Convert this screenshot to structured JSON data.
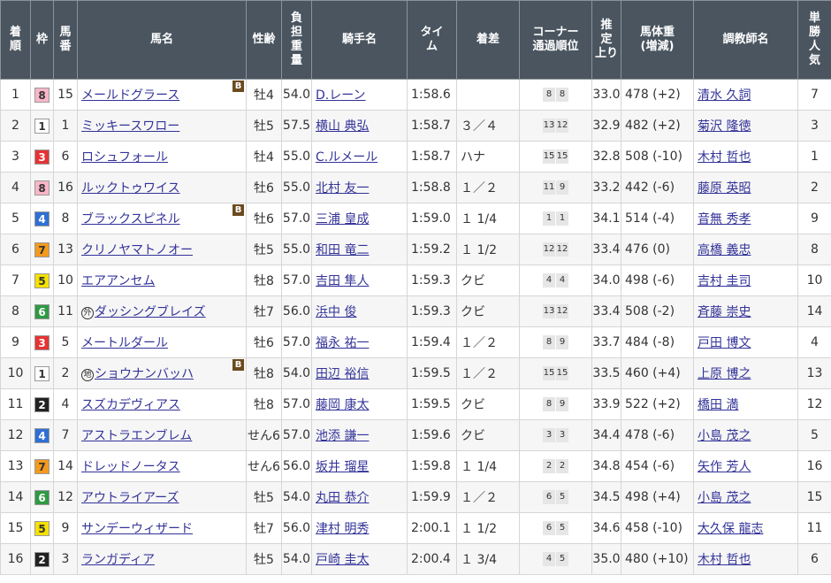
{
  "headers": [
    {
      "label": "着\n順"
    },
    {
      "label": "枠"
    },
    {
      "label": "馬\n番"
    },
    {
      "label": "馬名"
    },
    {
      "label": "性齢"
    },
    {
      "label": "負\n担\n重\n量"
    },
    {
      "label": "騎手名"
    },
    {
      "label": "タイ\nム"
    },
    {
      "label": "着差"
    },
    {
      "label": "コーナー\n通過順位"
    },
    {
      "label": "推\n定\n上り"
    },
    {
      "label": "馬体重\n(増減)"
    },
    {
      "label": "調教師名"
    },
    {
      "label": "単\n勝\n人\n気"
    }
  ],
  "waku_colors": {
    "1": {
      "bg": "#ffffff",
      "fg": "#333333"
    },
    "2": {
      "bg": "#222222",
      "fg": "#ffffff"
    },
    "3": {
      "bg": "#e63333",
      "fg": "#ffffff"
    },
    "4": {
      "bg": "#2f6fd6",
      "fg": "#ffffff"
    },
    "5": {
      "bg": "#f5e000",
      "fg": "#333333"
    },
    "6": {
      "bg": "#2e9a44",
      "fg": "#ffffff"
    },
    "7": {
      "bg": "#f39a1e",
      "fg": "#333333"
    },
    "8": {
      "bg": "#f8b6c8",
      "fg": "#333333"
    }
  },
  "rows": [
    {
      "rank": "1",
      "waku": "8",
      "num": "15",
      "mark": "",
      "mark_icon": "",
      "horse": "メールドグラース",
      "blinker": "B",
      "sexage": "牡4",
      "weight": "54.0",
      "jockey": "D.レーン",
      "time": "1:58.6",
      "margin": "",
      "c1": "8",
      "c2": "8",
      "last3f": "33.0",
      "body": "478 (+2)",
      "trainer": "清水 久詞",
      "pop": "7"
    },
    {
      "rank": "2",
      "waku": "1",
      "num": "1",
      "mark": "",
      "mark_icon": "",
      "horse": "ミッキースワロー",
      "blinker": "",
      "sexage": "牡5",
      "weight": "57.5",
      "jockey": "横山 典弘",
      "time": "1:58.7",
      "margin": "３／４",
      "c1": "13",
      "c2": "12",
      "last3f": "32.9",
      "body": "482 (+2)",
      "trainer": "菊沢 隆徳",
      "pop": "3"
    },
    {
      "rank": "3",
      "waku": "3",
      "num": "6",
      "mark": "",
      "mark_icon": "",
      "horse": "ロシュフォール",
      "blinker": "",
      "sexage": "牡4",
      "weight": "55.0",
      "jockey": "C.ルメール",
      "time": "1:58.7",
      "margin": "ハナ",
      "c1": "15",
      "c2": "15",
      "last3f": "32.8",
      "body": "508 (-10)",
      "trainer": "木村 哲也",
      "pop": "1"
    },
    {
      "rank": "4",
      "waku": "8",
      "num": "16",
      "mark": "",
      "mark_icon": "",
      "horse": "ルックトゥワイス",
      "blinker": "",
      "sexage": "牡6",
      "weight": "55.0",
      "jockey": "北村 友一",
      "time": "1:58.8",
      "margin": "１／２",
      "c1": "11",
      "c2": "9",
      "last3f": "33.2",
      "body": "442 (-6)",
      "trainer": "藤原 英昭",
      "pop": "2"
    },
    {
      "rank": "5",
      "waku": "4",
      "num": "8",
      "mark": "",
      "mark_icon": "",
      "horse": "ブラックスピネル",
      "blinker": "B",
      "sexage": "牡6",
      "weight": "57.0",
      "jockey": "三浦 皇成",
      "time": "1:59.0",
      "margin": "１ 1/4",
      "c1": "1",
      "c2": "1",
      "last3f": "34.1",
      "body": "514 (-4)",
      "trainer": "音無 秀孝",
      "pop": "9"
    },
    {
      "rank": "6",
      "waku": "7",
      "num": "13",
      "mark": "",
      "mark_icon": "",
      "horse": "クリノヤマトノオー",
      "blinker": "",
      "sexage": "牡5",
      "weight": "55.0",
      "jockey": "和田 竜二",
      "time": "1:59.2",
      "margin": "１ 1/2",
      "c1": "12",
      "c2": "12",
      "last3f": "33.4",
      "body": "476 (0)",
      "trainer": "高橋 義忠",
      "pop": "8"
    },
    {
      "rank": "7",
      "waku": "5",
      "num": "10",
      "mark": "",
      "mark_icon": "",
      "horse": "エアアンセム",
      "blinker": "",
      "sexage": "牡8",
      "weight": "57.0",
      "jockey": "吉田 隼人",
      "time": "1:59.3",
      "margin": "クビ",
      "c1": "4",
      "c2": "4",
      "last3f": "34.0",
      "body": "498 (-6)",
      "trainer": "吉村 圭司",
      "pop": "10"
    },
    {
      "rank": "8",
      "waku": "6",
      "num": "11",
      "mark": "外",
      "mark_icon": "foreign-mark-icon",
      "horse": "ダッシングブレイズ",
      "blinker": "",
      "sexage": "牡7",
      "weight": "56.0",
      "jockey": "浜中 俊",
      "time": "1:59.3",
      "margin": "クビ",
      "c1": "13",
      "c2": "12",
      "last3f": "33.4",
      "body": "508 (-2)",
      "trainer": "斉藤 崇史",
      "pop": "14"
    },
    {
      "rank": "9",
      "waku": "3",
      "num": "5",
      "mark": "",
      "mark_icon": "",
      "horse": "メートルダール",
      "blinker": "",
      "sexage": "牡6",
      "weight": "57.0",
      "jockey": "福永 祐一",
      "time": "1:59.4",
      "margin": "１／２",
      "c1": "8",
      "c2": "9",
      "last3f": "33.7",
      "body": "484 (-8)",
      "trainer": "戸田 博文",
      "pop": "4"
    },
    {
      "rank": "10",
      "waku": "1",
      "num": "2",
      "mark": "地",
      "mark_icon": "local-mark-icon",
      "horse": "ショウナンバッハ",
      "blinker": "B",
      "sexage": "牡8",
      "weight": "54.0",
      "jockey": "田辺 裕信",
      "time": "1:59.5",
      "margin": "１／２",
      "c1": "15",
      "c2": "15",
      "last3f": "33.5",
      "body": "460 (+4)",
      "trainer": "上原 博之",
      "pop": "13"
    },
    {
      "rank": "11",
      "waku": "2",
      "num": "4",
      "mark": "",
      "mark_icon": "",
      "horse": "スズカデヴィアス",
      "blinker": "",
      "sexage": "牡8",
      "weight": "57.0",
      "jockey": "藤岡 康太",
      "time": "1:59.5",
      "margin": "クビ",
      "c1": "8",
      "c2": "9",
      "last3f": "33.9",
      "body": "522 (+2)",
      "trainer": "橋田 満",
      "pop": "12"
    },
    {
      "rank": "12",
      "waku": "4",
      "num": "7",
      "mark": "",
      "mark_icon": "",
      "horse": "アストラエンブレム",
      "blinker": "",
      "sexage": "せん6",
      "weight": "57.0",
      "jockey": "池添 謙一",
      "time": "1:59.6",
      "margin": "クビ",
      "c1": "3",
      "c2": "3",
      "last3f": "34.4",
      "body": "478 (-6)",
      "trainer": "小島 茂之",
      "pop": "5"
    },
    {
      "rank": "13",
      "waku": "7",
      "num": "14",
      "mark": "",
      "mark_icon": "",
      "horse": "ドレッドノータス",
      "blinker": "",
      "sexage": "せん6",
      "weight": "56.0",
      "jockey": "坂井 瑠星",
      "time": "1:59.8",
      "margin": "１ 1/4",
      "c1": "2",
      "c2": "2",
      "last3f": "34.8",
      "body": "454 (-6)",
      "trainer": "矢作 芳人",
      "pop": "16"
    },
    {
      "rank": "14",
      "waku": "6",
      "num": "12",
      "mark": "",
      "mark_icon": "",
      "horse": "アウトライアーズ",
      "blinker": "",
      "sexage": "牡5",
      "weight": "54.0",
      "jockey": "丸田 恭介",
      "time": "1:59.9",
      "margin": "１／２",
      "c1": "6",
      "c2": "5",
      "last3f": "34.5",
      "body": "498 (+4)",
      "trainer": "小島 茂之",
      "pop": "15"
    },
    {
      "rank": "15",
      "waku": "5",
      "num": "9",
      "mark": "",
      "mark_icon": "",
      "horse": "サンデーウィザード",
      "blinker": "",
      "sexage": "牡7",
      "weight": "56.0",
      "jockey": "津村 明秀",
      "time": "2:00.1",
      "margin": "１ 1/2",
      "c1": "6",
      "c2": "5",
      "last3f": "34.6",
      "body": "458 (-10)",
      "trainer": "大久保 龍志",
      "pop": "11"
    },
    {
      "rank": "16",
      "waku": "2",
      "num": "3",
      "mark": "",
      "mark_icon": "",
      "horse": "ランガディア",
      "blinker": "",
      "sexage": "牡5",
      "weight": "54.0",
      "jockey": "戸崎 圭太",
      "time": "2:00.4",
      "margin": "１ 3/4",
      "c1": "4",
      "c2": "5",
      "last3f": "35.0",
      "body": "480 (+10)",
      "trainer": "木村 哲也",
      "pop": "6"
    }
  ]
}
